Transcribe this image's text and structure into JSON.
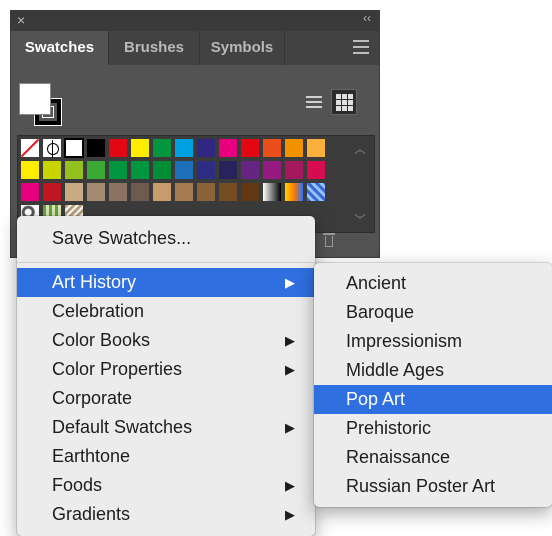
{
  "panel": {
    "tabs": [
      {
        "label": "Swatches",
        "active": true
      },
      {
        "label": "Brushes",
        "active": false
      },
      {
        "label": "Symbols",
        "active": false
      }
    ],
    "close_icon": "close-icon",
    "collapse_glyph": "‹‹"
  },
  "swatches": {
    "row1": [
      "none",
      "registration",
      "white",
      "#000000",
      "#e30613",
      "#ffed00",
      "#009640",
      "#00a0e3",
      "#312783",
      "#e6007e",
      "#e30613",
      "#e94e1b",
      "#f39200",
      "#fbb03b"
    ],
    "row2": [
      "#ffed00",
      "#c8d400",
      "#95c11f",
      "#3aaa35",
      "#009640",
      "#00963f",
      "#008d36",
      "#1d71b8",
      "#2d2e83",
      "#29235c",
      "#662483",
      "#951b81",
      "#a3195b",
      "#d60b51"
    ],
    "row3": [
      "#e6007e",
      "#be1622",
      "#c9ab83",
      "#a58a72",
      "#8b7261",
      "#6d5b4f",
      "#c69c6d",
      "#a67c52",
      "#8c6239",
      "#754c24",
      "#603813",
      "gradient-bw",
      "gradient-warm",
      "gradient-blue"
    ],
    "row4": [
      "pattern-dots",
      "pattern-green",
      "pattern-tan"
    ]
  },
  "menu": {
    "items": [
      {
        "label": "Save Swatches...",
        "submenu": false
      },
      {
        "label": "Art History",
        "submenu": true,
        "highlighted": true
      },
      {
        "label": "Celebration",
        "submenu": false
      },
      {
        "label": "Color Books",
        "submenu": true
      },
      {
        "label": "Color Properties",
        "submenu": true
      },
      {
        "label": "Corporate",
        "submenu": false
      },
      {
        "label": "Default Swatches",
        "submenu": true
      },
      {
        "label": "Earthtone",
        "submenu": false
      },
      {
        "label": "Foods",
        "submenu": true
      },
      {
        "label": "Gradients",
        "submenu": true
      }
    ],
    "arrow_glyph": "▶"
  },
  "submenu": {
    "items": [
      {
        "label": "Ancient"
      },
      {
        "label": "Baroque"
      },
      {
        "label": "Impressionism"
      },
      {
        "label": "Middle Ages"
      },
      {
        "label": "Pop Art",
        "highlighted": true
      },
      {
        "label": "Prehistoric"
      },
      {
        "label": "Renaissance"
      },
      {
        "label": "Russian Poster Art"
      }
    ]
  },
  "colors": {
    "highlight": "#2f6fe0",
    "panel_bg": "#535353",
    "menu_bg": "#ececec"
  }
}
